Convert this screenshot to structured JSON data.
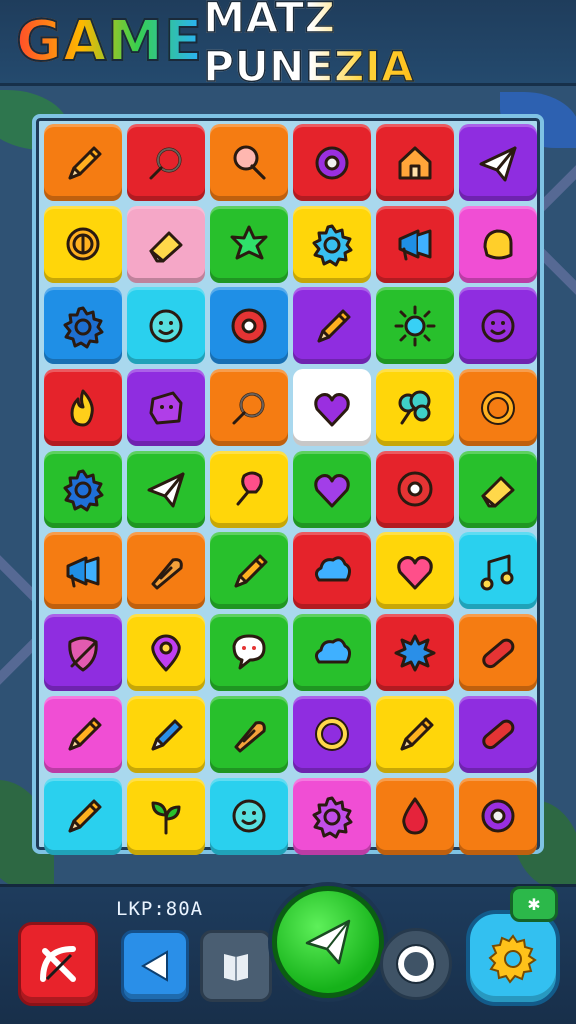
{
  "header": {
    "title_left": "GAME",
    "title_right": "MATZ PUNEZIA"
  },
  "hud": {
    "score_label": "LKP:80A",
    "badge_label": "✱"
  },
  "colors": {
    "orange": "#f57c12",
    "red": "#e5232b",
    "yellow": "#ffd60a",
    "pink": "#f5a7c7",
    "green": "#28c02c",
    "blue": "#1f8fe6",
    "cyan": "#2ad0ee",
    "purple": "#8f2de0",
    "magenta": "#f04ed4",
    "white": "#ffffff"
  },
  "board": {
    "rows": [
      [
        {
          "color": "orange",
          "icon": "pencil-icon"
        },
        {
          "color": "red",
          "icon": "magnifier-icon"
        },
        {
          "color": "orange",
          "icon": "ice-cream-icon"
        },
        {
          "color": "red",
          "icon": "donut-icon"
        },
        {
          "color": "red",
          "icon": "house-icon"
        },
        {
          "color": "purple",
          "icon": "paper-plane-icon"
        }
      ],
      [
        {
          "color": "yellow",
          "icon": "coin-icon"
        },
        {
          "color": "pink",
          "icon": "eraser-icon"
        },
        {
          "color": "green",
          "icon": "star-splat-icon"
        },
        {
          "color": "yellow",
          "icon": "gear-icon"
        },
        {
          "color": "red",
          "icon": "megaphone-icon"
        },
        {
          "color": "magenta",
          "icon": "hand-icon"
        }
      ],
      [
        {
          "color": "blue",
          "icon": "gear-icon"
        },
        {
          "color": "cyan",
          "icon": "smiley-icon"
        },
        {
          "color": "blue",
          "icon": "flower-icon"
        },
        {
          "color": "purple",
          "icon": "pencil-icon"
        },
        {
          "color": "green",
          "icon": "sun-icon"
        },
        {
          "color": "purple",
          "icon": "smiley-icon"
        }
      ],
      [
        {
          "color": "red",
          "icon": "flame-icon"
        },
        {
          "color": "purple",
          "icon": "cube-face-icon"
        },
        {
          "color": "orange",
          "icon": "magnifier-icon"
        },
        {
          "color": "white",
          "icon": "heart-icon"
        },
        {
          "color": "yellow",
          "icon": "tree-icon"
        },
        {
          "color": "orange",
          "icon": "ring-icon"
        }
      ],
      [
        {
          "color": "green",
          "icon": "gear-icon"
        },
        {
          "color": "green",
          "icon": "paper-plane-icon"
        },
        {
          "color": "yellow",
          "icon": "popsicle-icon"
        },
        {
          "color": "green",
          "icon": "heart-icon"
        },
        {
          "color": "red",
          "icon": "flower-icon"
        },
        {
          "color": "green",
          "icon": "eraser-icon"
        }
      ],
      [
        {
          "color": "orange",
          "icon": "megaphone-icon"
        },
        {
          "color": "orange",
          "icon": "shuttlecock-icon"
        },
        {
          "color": "green",
          "icon": "pencil-icon"
        },
        {
          "color": "red",
          "icon": "cloud-icon"
        },
        {
          "color": "yellow",
          "icon": "heart-icon"
        },
        {
          "color": "cyan",
          "icon": "music-note-icon"
        }
      ],
      [
        {
          "color": "purple",
          "icon": "shield-icon"
        },
        {
          "color": "yellow",
          "icon": "location-pin-icon"
        },
        {
          "color": "green",
          "icon": "speech-bubble-icon"
        },
        {
          "color": "green",
          "icon": "cloud-icon"
        },
        {
          "color": "red",
          "icon": "splat-icon"
        },
        {
          "color": "orange",
          "icon": "capsule-icon"
        }
      ],
      [
        {
          "color": "magenta",
          "icon": "pencil-icon"
        },
        {
          "color": "yellow",
          "icon": "marker-icon"
        },
        {
          "color": "green",
          "icon": "shuttlecock-icon"
        },
        {
          "color": "purple",
          "icon": "ring-icon"
        },
        {
          "color": "yellow",
          "icon": "pencil-icon"
        },
        {
          "color": "purple",
          "icon": "capsule-icon"
        }
      ],
      [
        {
          "color": "cyan",
          "icon": "pencil-icon"
        },
        {
          "color": "yellow",
          "icon": "sprout-icon"
        },
        {
          "color": "cyan",
          "icon": "smiley-icon"
        },
        {
          "color": "magenta",
          "icon": "gear-icon"
        },
        {
          "color": "orange",
          "icon": "drop-icon"
        },
        {
          "color": "orange",
          "icon": "donut-icon"
        }
      ]
    ]
  },
  "controls": [
    {
      "name": "wildcard-button",
      "icon": "crossed-bow-icon"
    },
    {
      "name": "back-button",
      "icon": "left-triangle-icon"
    },
    {
      "name": "book-button",
      "icon": "book-icon"
    },
    {
      "name": "play-button",
      "icon": "paper-plane-icon"
    },
    {
      "name": "ring-button",
      "icon": "ring-icon"
    },
    {
      "name": "settings-button",
      "icon": "gear-icon"
    }
  ]
}
